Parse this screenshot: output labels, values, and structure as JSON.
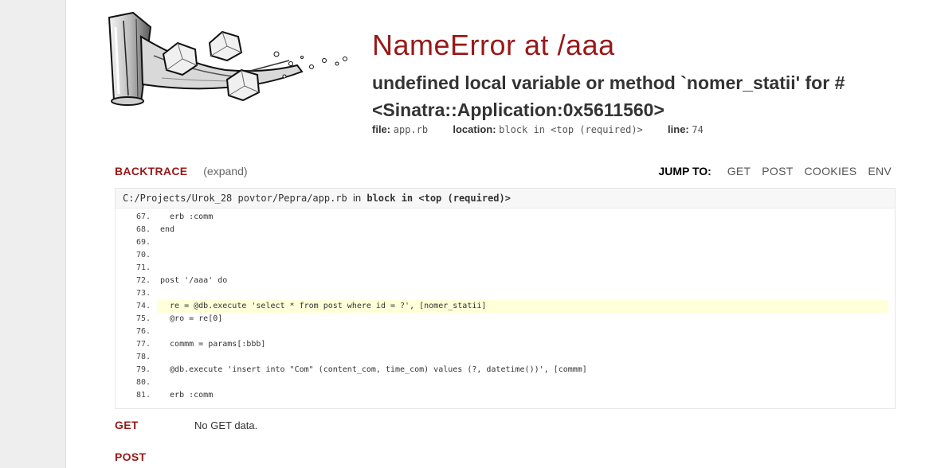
{
  "header": {
    "title": "NameError at /aaa",
    "message": "undefined local variable or method `nomer_statii' for #<Sinatra::Application:0x5611560>",
    "file_label": "file:",
    "file_value": "app.rb",
    "location_label": "location:",
    "location_value": "block in <top (required)>",
    "line_label": "line:",
    "line_value": "74"
  },
  "backtrace": {
    "title": "BACKTRACE",
    "expand": "(expand)",
    "jump_label": "JUMP TO:",
    "jump_links": [
      "GET",
      "POST",
      "COOKIES",
      "ENV"
    ],
    "frame": {
      "path": "C:/Projects/Urok_28 povtor/Pepra/app.rb",
      "in": "in",
      "context": "block in <top (required)>",
      "highlight_line": 74,
      "lines": [
        {
          "num": "67.",
          "code": "  erb :comm"
        },
        {
          "num": "68.",
          "code": "end"
        },
        {
          "num": "69.",
          "code": ""
        },
        {
          "num": "70.",
          "code": ""
        },
        {
          "num": "71.",
          "code": ""
        },
        {
          "num": "72.",
          "code": "post '/aaa' do"
        },
        {
          "num": "73.",
          "code": ""
        },
        {
          "num": "74.",
          "code": "  re = @db.execute 'select * from post where id = ?', [nomer_statii]"
        },
        {
          "num": "75.",
          "code": "  @ro = re[0]"
        },
        {
          "num": "76.",
          "code": ""
        },
        {
          "num": "77.",
          "code": "  commm = params[:bbb]"
        },
        {
          "num": "78.",
          "code": ""
        },
        {
          "num": "79.",
          "code": "  @db.execute 'insert into \"Com\" (content_com, time_com) values (?, datetime())', [commm]"
        },
        {
          "num": "80.",
          "code": ""
        },
        {
          "num": "81.",
          "code": "  erb :comm"
        }
      ]
    }
  },
  "get": {
    "title": "GET",
    "note": "No GET data."
  },
  "post": {
    "title": "POST"
  },
  "colors": {
    "accent": "#981919",
    "highlight": "#ffffd9"
  }
}
